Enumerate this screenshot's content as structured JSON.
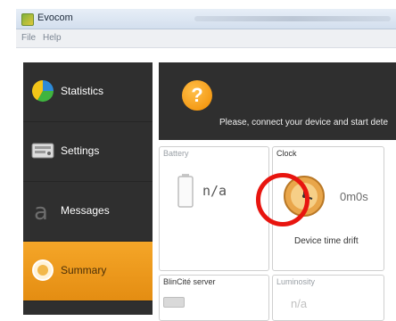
{
  "window": {
    "title": "Evocom"
  },
  "menu": [
    {
      "label": "File"
    },
    {
      "label": "Help"
    }
  ],
  "sidebar": {
    "items": [
      {
        "label": "Statistics",
        "icon": "statistics-icon",
        "active": false
      },
      {
        "label": "Settings",
        "icon": "settings-icon",
        "active": false
      },
      {
        "label": "Messages",
        "icon": "messages-icon",
        "active": false
      },
      {
        "label": "Summary",
        "icon": "summary-icon",
        "active": true
      }
    ]
  },
  "banner": {
    "message": "Please, connect your device and start dete"
  },
  "cards": {
    "battery": {
      "label": "Battery",
      "value": "n/a"
    },
    "clock": {
      "label": "Clock",
      "value": "0m0s",
      "caption": "Device time drift"
    },
    "bluetooth": {
      "label": "BlinCité server"
    },
    "luminosity": {
      "label": "Luminosity",
      "value": "n/a"
    }
  },
  "colors": {
    "accent": "#f5a628",
    "highlight": "#e8150f",
    "sidebar": "#2f2f2f"
  }
}
